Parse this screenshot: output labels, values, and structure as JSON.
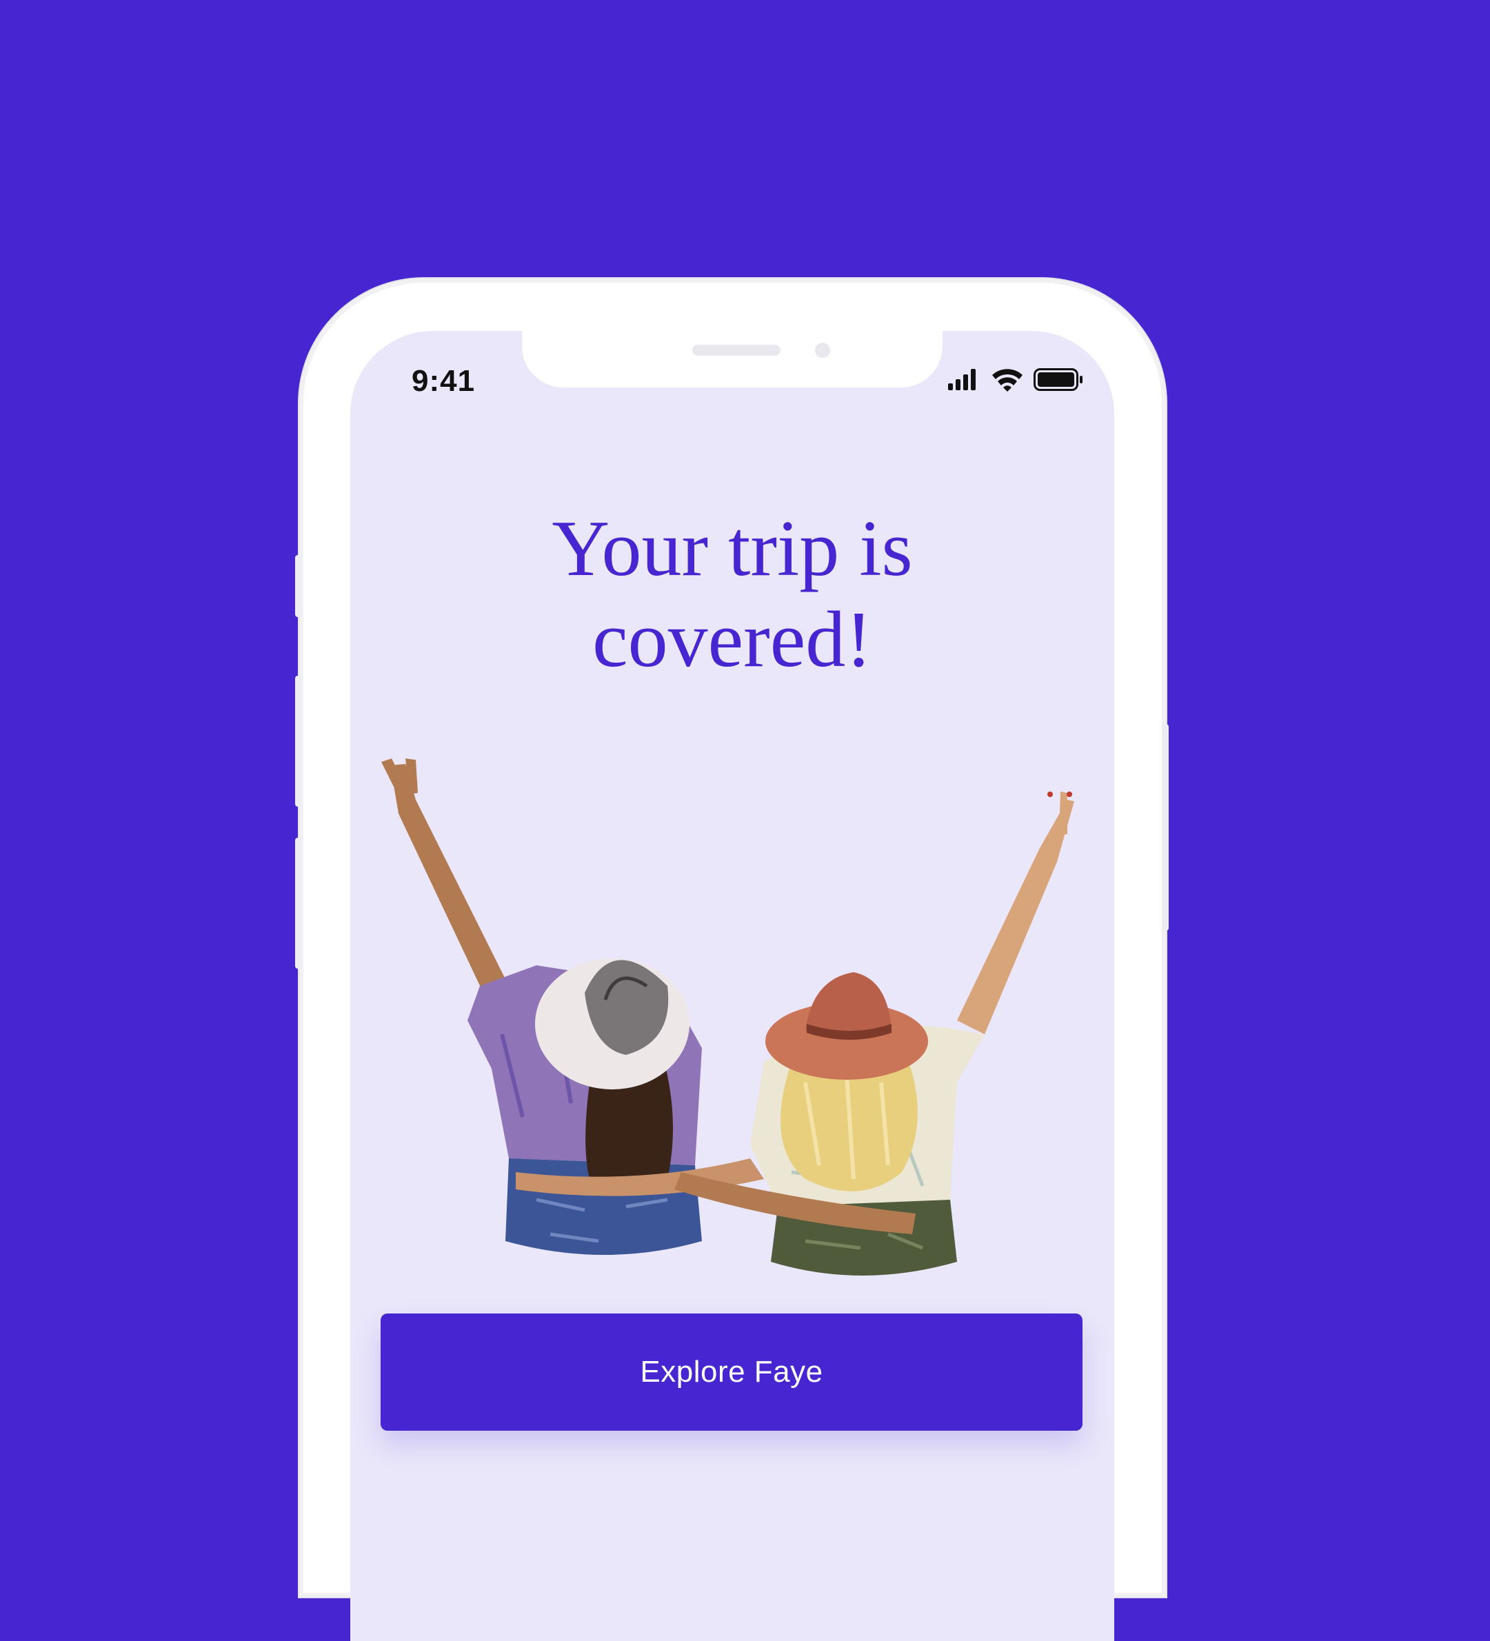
{
  "status_bar": {
    "time": "9:41",
    "icons": [
      "signal-icon",
      "wifi-icon",
      "battery-icon"
    ]
  },
  "headline": {
    "line1": "Your trip is",
    "line2": "covered!"
  },
  "illustration": {
    "icon": "two-friends-illustration"
  },
  "cta": {
    "label": "Explore Faye"
  },
  "colors": {
    "brand": "#4725d1",
    "screen_bg": "#eae7fa",
    "button_text": "#ffffff"
  }
}
